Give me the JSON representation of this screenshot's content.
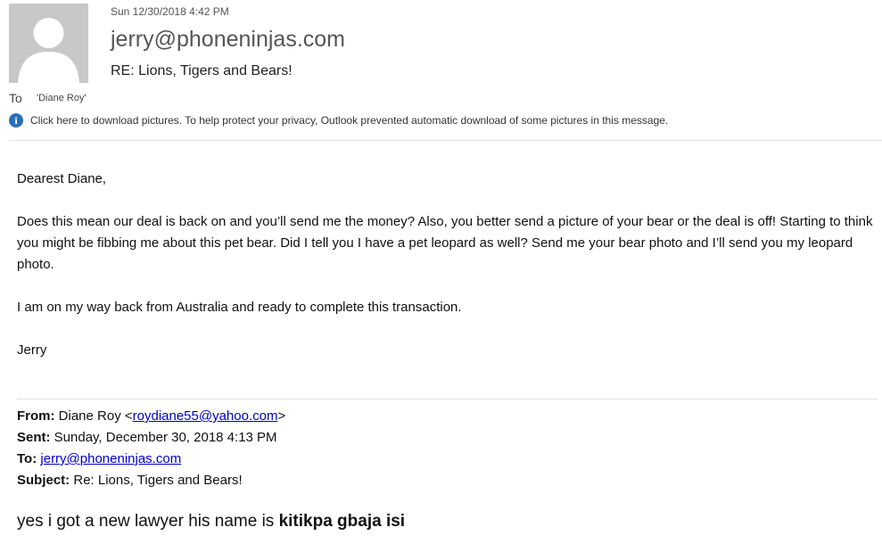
{
  "header": {
    "date": "Sun 12/30/2018 4:42 PM",
    "from": "jerry@phoneninjas.com",
    "subject": "RE: Lions, Tigers and Bears!",
    "to_label": "To",
    "to_value": "'Diane Roy'",
    "info_message": "Click here to download pictures. To help protect your privacy, Outlook prevented automatic download of some pictures in this message."
  },
  "body": {
    "greeting": "Dearest Diane,",
    "paragraph1": "Does this mean our deal is back on and you’ll send me the money?  Also, you better send a picture of your bear or the deal is off!  Starting to think you might be fibbing me about this pet bear.  Did I tell you I have a pet leopard as well?  Send me your bear photo and I’ll send you my leopard photo.",
    "paragraph2": "I am on my way back from Australia and ready to complete this transaction.",
    "signature": "Jerry"
  },
  "quoted": {
    "from_label": "From:",
    "from_name": "Diane Roy <",
    "from_email": "roydiane55@yahoo.com",
    "from_close": ">",
    "sent_label": "Sent:",
    "sent_value": "Sunday, December 30, 2018 4:13 PM",
    "to_label": "To:",
    "to_email": "jerry@phoneninjas.com",
    "subject_label": "Subject:",
    "subject_value": "Re: Lions, Tigers and Bears!"
  },
  "reply": {
    "text": "yes i got a new lawyer his name is ",
    "bold_name": "kitikpa gbaja isi"
  },
  "colors": {
    "avatar_bg": "#c8c8c8",
    "info_icon": "#2a6ebb",
    "link": "#0000cc"
  },
  "icons": {
    "avatar": "person-silhouette-icon",
    "info": "info-icon"
  }
}
